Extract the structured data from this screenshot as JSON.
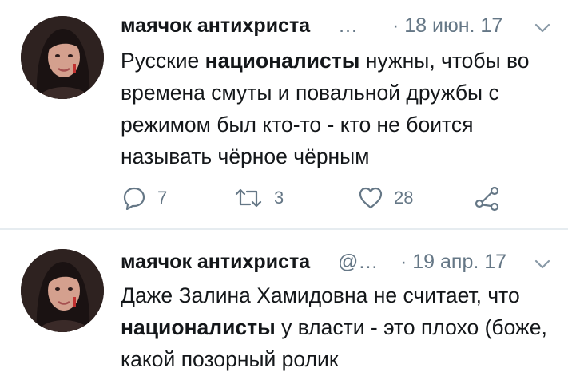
{
  "tweets": [
    {
      "author_name": "маячок антихриста",
      "handle": "…",
      "date": "· 18 июн. 17",
      "text_segments": [
        {
          "text": "Русские ",
          "bold": false
        },
        {
          "text": "националисты",
          "bold": true
        },
        {
          "text": " нужны, чтобы во времена смуты и повальной дружбы с режимом был кто-то - кто не боится называть чёрное чёрным",
          "bold": false
        }
      ],
      "counts": {
        "replies": "7",
        "retweets": "3",
        "likes": "28"
      }
    },
    {
      "author_name": "маячок антихриста",
      "handle": "@…",
      "date": "· 19 апр. 17",
      "text_segments": [
        {
          "text": "Даже Залина Хамидовна не считает, что ",
          "bold": false
        },
        {
          "text": "националисты",
          "bold": true
        },
        {
          "text": " у власти  - это плохо (боже, какой позорный ролик",
          "bold": false
        }
      ]
    }
  ],
  "icons": {
    "reply": "reply-icon",
    "retweet": "retweet-icon",
    "like": "heart-icon",
    "share": "share-icon",
    "menu": "chevron-down-icon"
  },
  "colors": {
    "text": "#14171a",
    "secondary": "#657786",
    "divider": "#e6ecf0"
  }
}
